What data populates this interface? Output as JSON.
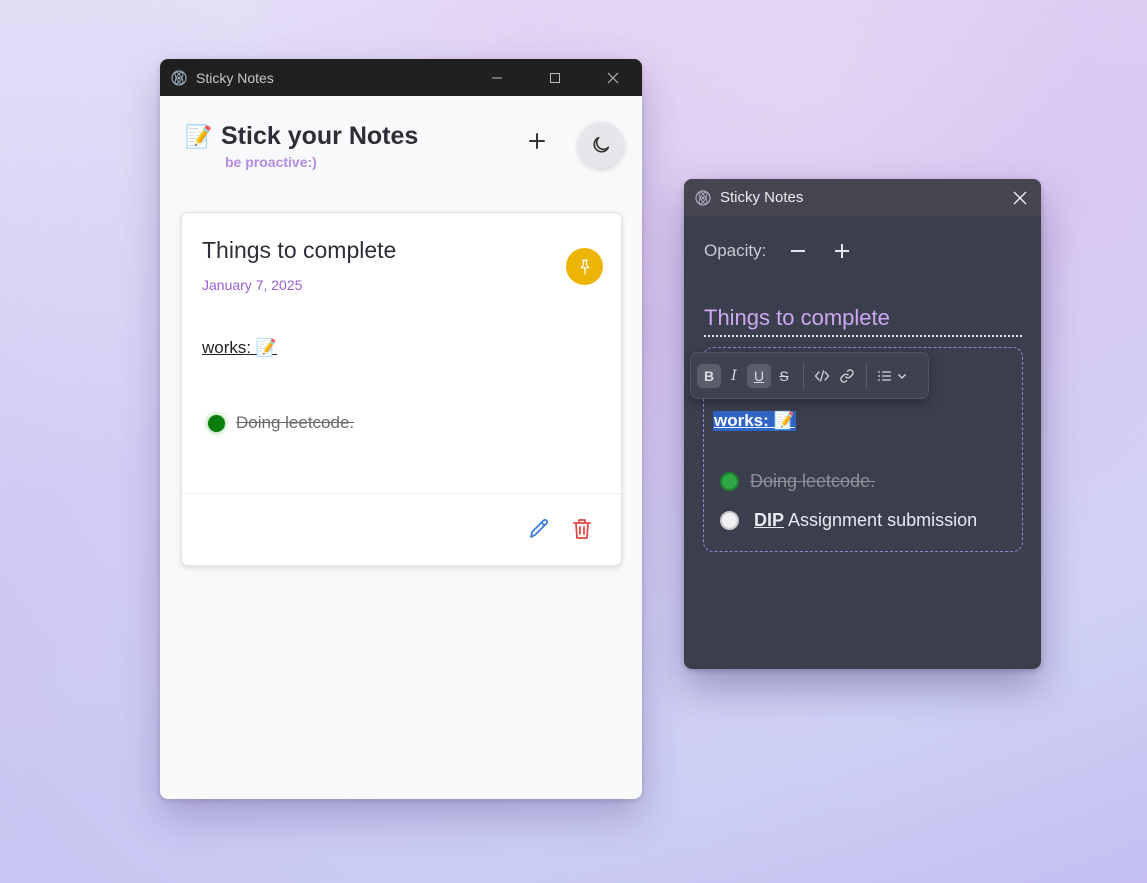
{
  "main_window": {
    "title": "Sticky Notes",
    "app_title": "Stick your Notes",
    "app_subtitle": "be proactive:)",
    "memo_emoji": "📝",
    "note": {
      "title": "Things to complete",
      "date": "January 7, 2025",
      "works_text": "works: 📝",
      "todos": [
        {
          "text": "Doing leetcode.",
          "done": true
        }
      ]
    }
  },
  "note_window": {
    "title": "Sticky Notes",
    "opacity_label": "Opacity:",
    "note_title": "Things to complete",
    "works_text": "works: 📝",
    "todos": [
      {
        "text": "Doing leetcode.",
        "done": true
      },
      {
        "bold_part": "DIP",
        "rest": " Assignment submission",
        "done": false
      }
    ],
    "toolbar": {
      "bold": "B",
      "italic": "I",
      "underline": "U",
      "strike": "S"
    }
  },
  "colors": {
    "accent_purple": "#9a60d6",
    "pin_yellow": "#ecb405",
    "done_green": "#0a7d0a",
    "selection_blue": "#2f64c4"
  },
  "icons": [
    "app-icon",
    "minimize-icon",
    "maximize-icon",
    "close-icon",
    "plus-icon",
    "moon-icon",
    "pin-icon",
    "edit-icon",
    "trash-icon",
    "minus-icon",
    "code-icon",
    "link-icon",
    "list-icon",
    "chevron-down-icon"
  ]
}
